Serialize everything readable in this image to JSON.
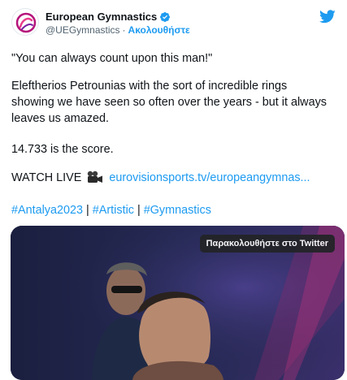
{
  "account": {
    "name": "European Gymnastics",
    "handle": "@UEGymnastics",
    "separator": "·",
    "follow_label": "Ακολουθήστε",
    "verified": true
  },
  "tweet": {
    "line1": "\"You can always count upon this man!\"",
    "line2": "Eleftherios Petrounias with the sort of incredible rings showing we have seen so often over the years - but it always leaves us amazed.",
    "line3": "14.733 is the score.",
    "watch_label": "WATCH LIVE",
    "watch_link": "eurovisionsports.tv/europeangymnas...",
    "hashtag1": "#Antalya2023",
    "divider": "|",
    "hashtag2": "#Artistic",
    "hashtag3": "#Gymnastics"
  },
  "media": {
    "watch_button_label": "Παρακολουθήστε στο Twitter"
  },
  "icons": {
    "twitter": "twitter-bird-icon",
    "verified": "verified-badge-icon",
    "camera": "movie-camera-emoji"
  },
  "colors": {
    "accent": "#1d9bf0",
    "text": "#0f1419",
    "muted": "#536471",
    "logo": "#b5137a"
  }
}
